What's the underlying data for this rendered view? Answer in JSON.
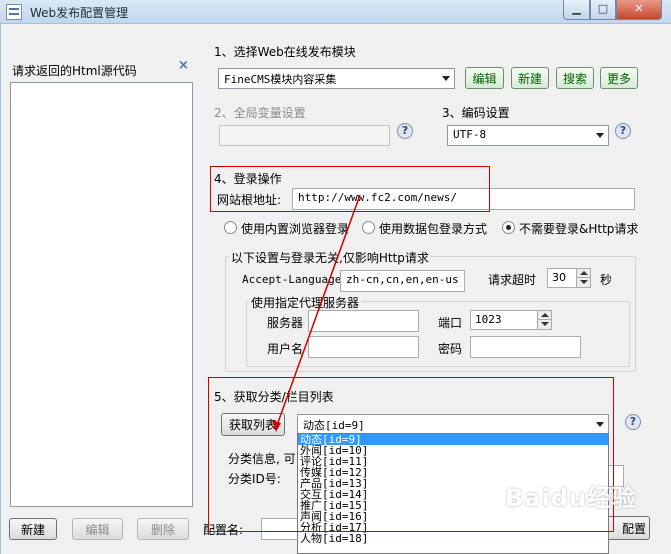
{
  "window": {
    "title": "Web发布配置管理"
  },
  "left_panel": {
    "title": "请求返回的Html源代码",
    "close_glyph": "×"
  },
  "section1": {
    "title": "1、选择Web在线发布模块",
    "module_select": "FineCMS模块内容采集",
    "buttons": {
      "edit": "编辑",
      "new": "新建",
      "search": "搜索",
      "more": "更多"
    }
  },
  "section2": {
    "title": "2、全局变量设置",
    "value": ""
  },
  "section3": {
    "title": "3、编码设置",
    "encoding": "UTF-8"
  },
  "section4": {
    "title": "4、登录操作",
    "site_root_label": "网站根地址:",
    "site_root_value": "http://www.fc2.com/news/",
    "radio_options": [
      "使用内置浏览器登录",
      "使用数据包登录方式",
      "不需要登录&Http请求"
    ],
    "selected_radio": 2,
    "http_group_title": "以下设置与登录无关,仅影响Http请求",
    "accept_language_label": "Accept-Language",
    "accept_language_value": "zh-cn,cn,en,en-us",
    "timeout_label": "请求超时",
    "timeout_value": "30",
    "timeout_unit": "秒",
    "proxy_group_title": "使用指定代理服务器",
    "server_label": "服务器",
    "port_label": "端口",
    "port_value": "1023",
    "username_label": "用户名",
    "password_label": "密码"
  },
  "section5": {
    "title": "5、获取分类/栏目列表",
    "fetch_button": "获取列表",
    "category_select": "动态[id=9]",
    "category_info_label": "分类信息, 可",
    "category_id_label": "分类ID号:",
    "options": [
      "动态[id=9]",
      "外闻[id=10]",
      "评论[id=11]",
      "传媒[id=12]",
      "产品[id=13]",
      "交互[id=14]",
      "推广[id=15]",
      "声闻[id=16]",
      "分析[id=17]",
      "人物[id=18]"
    ],
    "selected_index": 0
  },
  "bottom": {
    "new_button": "新建",
    "edit_button": "编辑",
    "delete_button": "删除",
    "config_name_label": "配置名:",
    "save_button_partial": "配置"
  },
  "colors": {
    "annotation": "#d00000",
    "selection": "#3399ff"
  },
  "watermark": "Baidu经验"
}
